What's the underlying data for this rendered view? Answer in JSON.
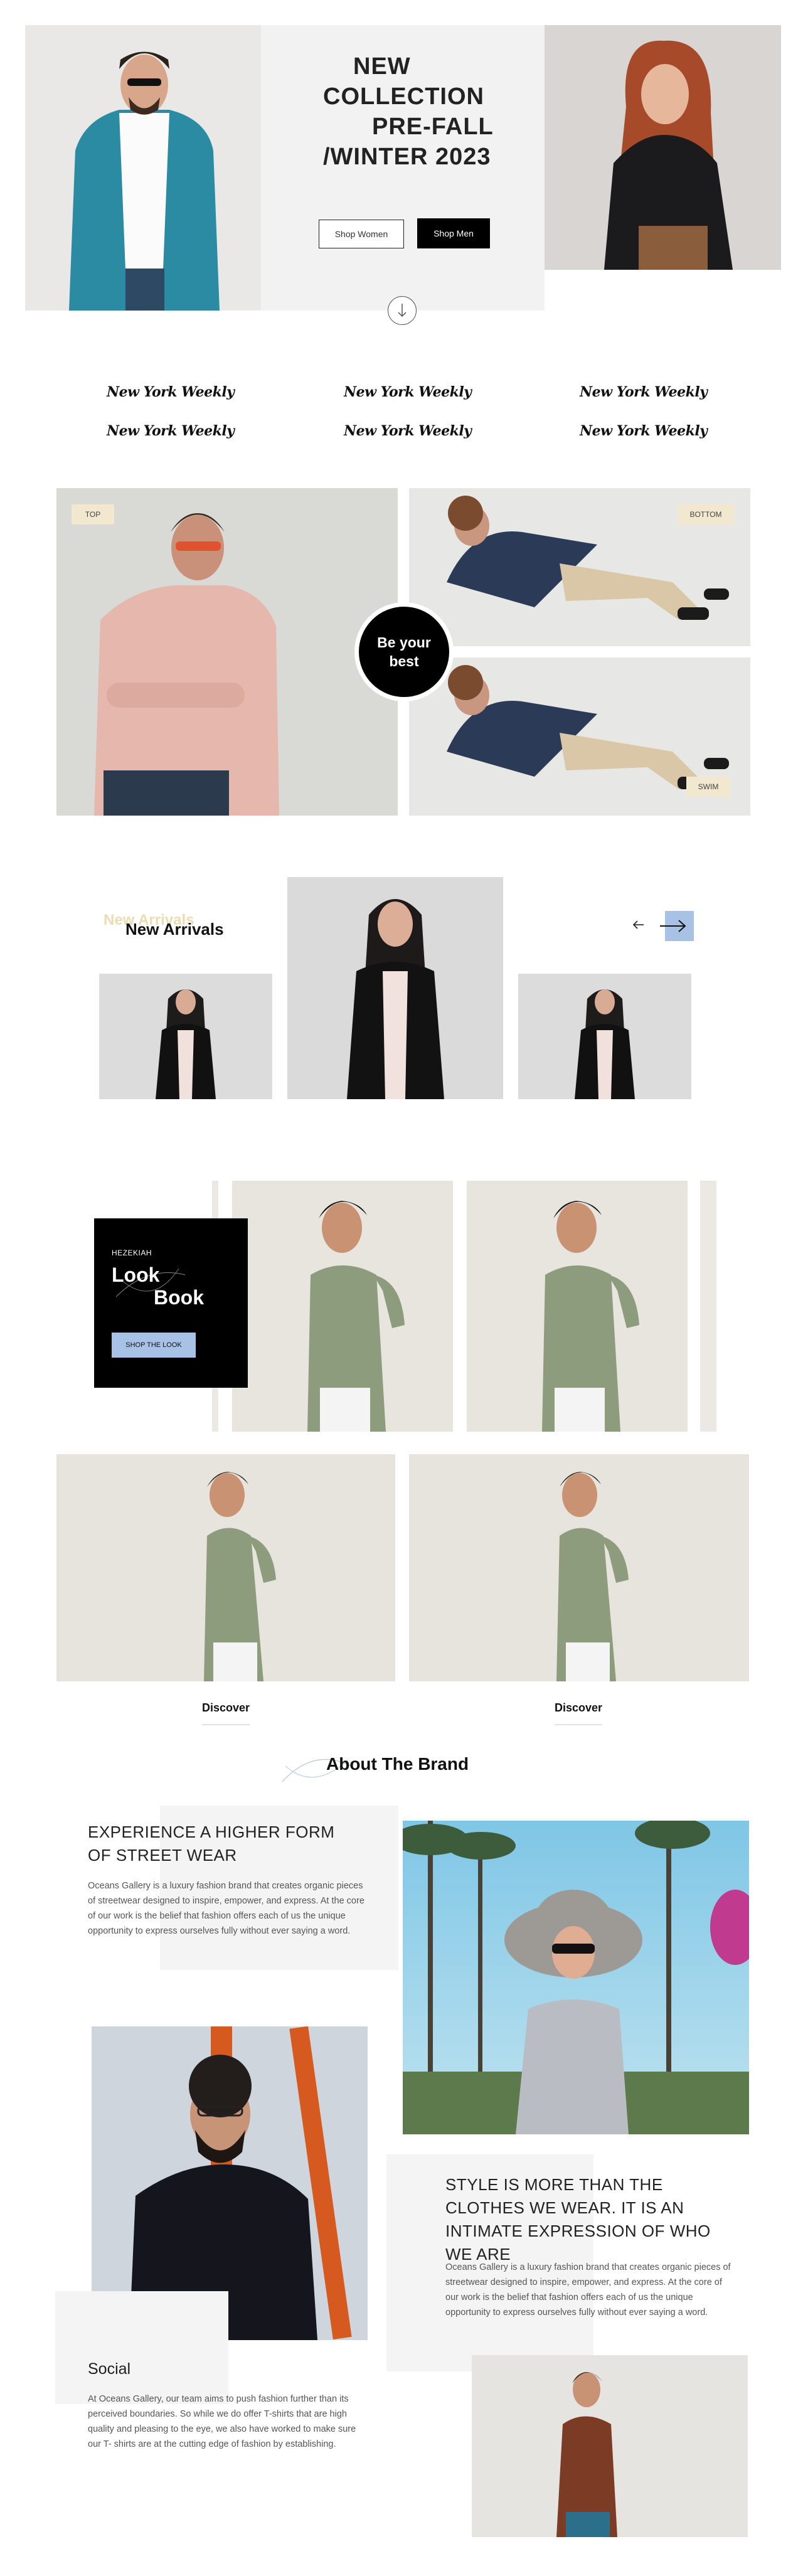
{
  "hero": {
    "title_lines": [
      "NEW",
      "COLLECTION",
      "PRE-FALL",
      "/WINTER 2023"
    ],
    "shop_women": "Shop Women",
    "shop_men": "Shop Men",
    "scroll_icon": "arrow-down-icon"
  },
  "press": {
    "logos": [
      "New York Weekly",
      "New York Weekly",
      "New York Weekly",
      "New York Weekly",
      "New York Weekly",
      "New York Weekly"
    ]
  },
  "categories": {
    "tag_top": "TOP",
    "tag_bottom": "BOTTOM",
    "tag_swim": "SWIM",
    "center_circle": "Be your best"
  },
  "arrivals": {
    "ghost_title": "New Arrivals",
    "title": "New Arrivals",
    "prev_icon": "arrow-left-icon",
    "next_icon": "arrow-right-icon"
  },
  "lookbook": {
    "brand": "HEZEKIAH",
    "word1": "Look",
    "word2": "Book",
    "button": "SHOP THE LOOK"
  },
  "discover": {
    "left": "Discover",
    "right": "Discover"
  },
  "about": {
    "title": "About The Brand",
    "block1_heading": "EXPERIENCE A HIGHER FORM OF STREET WEAR",
    "block1_text": "Oceans Gallery is a luxury fashion brand that creates organic pieces of streetwear designed to inspire, empower, and express. At the core of our work is the belief that fashion offers each of us the unique opportunity to express ourselves fully without ever saying a word.",
    "block2_heading": "STYLE IS MORE THAN THE CLOTHES WE WEAR. IT IS AN INTIMATE EXPRESSION OF WHO WE ARE",
    "block2_text": "Oceans Gallery is a luxury fashion brand that creates organic pieces of streetwear designed to inspire, empower, and express. At the core of our work is the belief that fashion offers each of us the unique opportunity to express ourselves fully without ever saying a word.",
    "social_heading": "Social",
    "social_text": "At Oceans Gallery, our team aims to push fashion further than its perceived boundaries. So while we do offer T-shirts that are high quality and pleasing to the eye, we also have worked to make sure our T- shirts are at the cutting edge of fashion by establishing."
  },
  "colors": {
    "accent_blue": "#a7c2e4",
    "tag_beige": "#f1e8cf",
    "panel_grey": "#f4f4f4"
  }
}
